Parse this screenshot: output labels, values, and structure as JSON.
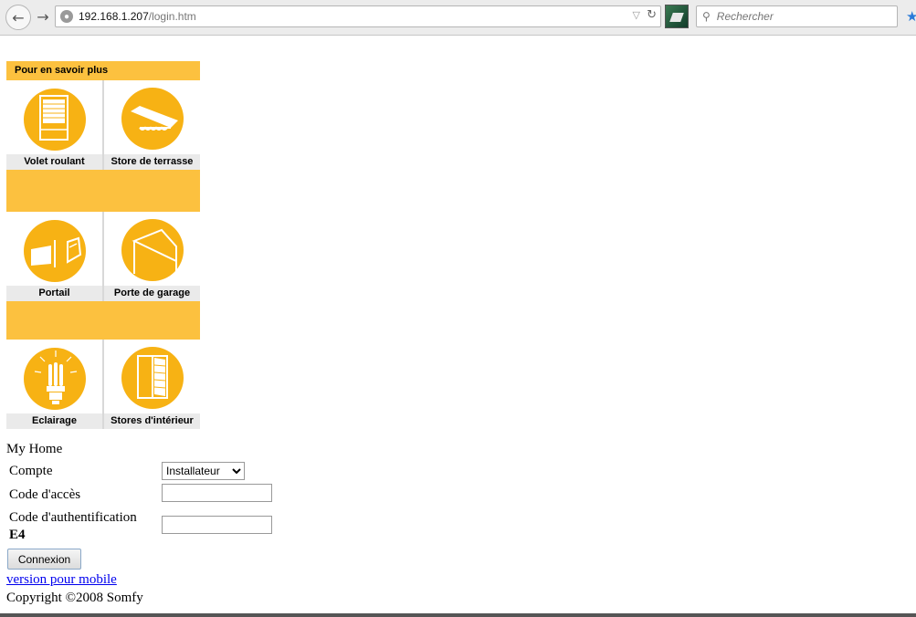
{
  "browser": {
    "url_host": "192.168.1.207",
    "url_path": "/login.htm",
    "search_placeholder": "Rechercher"
  },
  "panel": {
    "header": "Pour en savoir plus",
    "items": [
      {
        "label": "Volet roulant",
        "icon": "roller-shutter-icon"
      },
      {
        "label": "Store de terrasse",
        "icon": "awning-icon"
      },
      {
        "label": "Portail",
        "icon": "gate-icon"
      },
      {
        "label": "Porte de garage",
        "icon": "garage-door-icon"
      },
      {
        "label": "Eclairage",
        "icon": "lightbulb-icon"
      },
      {
        "label": "Stores d'intérieur",
        "icon": "interior-blind-icon"
      }
    ]
  },
  "form": {
    "title": "My Home",
    "compte_label": "Compte",
    "compte_value": "Installateur",
    "access_label": "Code d'accès",
    "auth_label": "Code d'authentification",
    "auth_code": "E4",
    "submit_label": "Connexion",
    "mobile_link": "version pour mobile",
    "copyright": "Copyright ©2008 Somfy"
  },
  "colors": {
    "accent": "#fcc13f",
    "icon_fill": "#f7b214",
    "caption_bg": "#eaeaea",
    "link": "#0000ee"
  }
}
